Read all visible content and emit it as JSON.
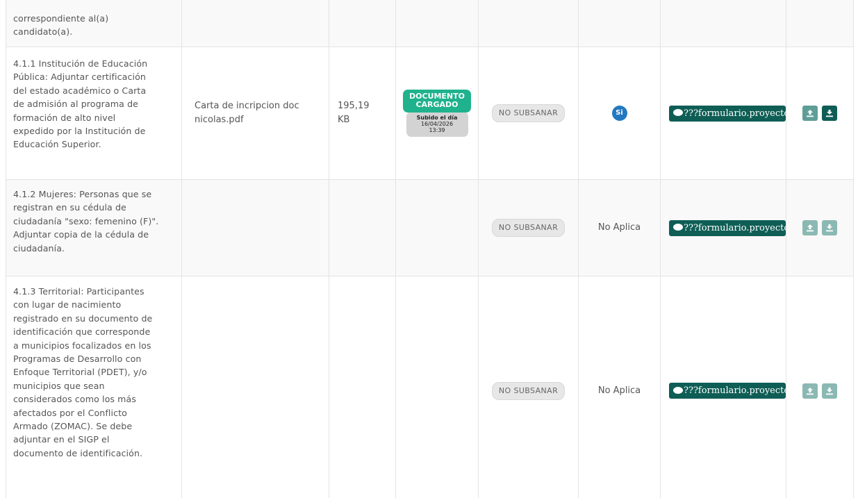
{
  "rows": [
    {
      "desc_lines": [
        "correspondiente al(a)",
        "candidato(a)."
      ]
    },
    {
      "desc_lines": [
        "4.1.1 Institución de Educación",
        "Pública: Adjuntar certificación",
        "del estado académico o Carta",
        "de admisión al programa de",
        "formación de alto nivel",
        "expedido por la Institución de",
        "Educación Superior."
      ],
      "file_name_lines": [
        "Carta de incripcion doc",
        "nicolas.pdf"
      ],
      "file_size_lines": [
        "195,19",
        "KB"
      ],
      "doc_status": "DOCUMENTO CARGADO",
      "upload_label": "Subido el día",
      "upload_date": "16/04/2026",
      "upload_time": "13:39",
      "subsanar": "NO SUBSANAR",
      "verify": "Si",
      "form_label": "???formulario.proyecto",
      "icons": {
        "upload": "upload-icon",
        "download": "download-icon"
      }
    },
    {
      "desc_lines": [
        "4.1.2 Mujeres: Personas que se",
        "registran en su cédula de",
        "ciudadanía \"sexo: femenino (F)\".",
        "Adjuntar copia de la cédula de",
        "ciudadanía."
      ],
      "subsanar": "NO SUBSANAR",
      "verify": "No Aplica",
      "form_label": "???formulario.proyecto"
    },
    {
      "desc_lines": [
        "4.1.3 Territorial: Participantes",
        "con lugar de nacimiento",
        "registrado en su documento de",
        "identificación que corresponde",
        "a municipios focalizados en los",
        "Programas de Desarrollo con",
        "Enfoque Territorial (PDET), y/o",
        "municipios que sean",
        "considerados como los más",
        "afectados por el Conflicto",
        "Armado (ZOMAC). Se debe",
        "adjuntar en el SIGP el",
        "documento de identificación."
      ],
      "subsanar": "NO SUBSANAR",
      "verify": "No Aplica",
      "form_label": "???formulario.proyecto"
    }
  ],
  "colors": {
    "accent": "#0f5e56",
    "doc_badge": "#1fb28d",
    "si_badge": "#2379c0"
  }
}
